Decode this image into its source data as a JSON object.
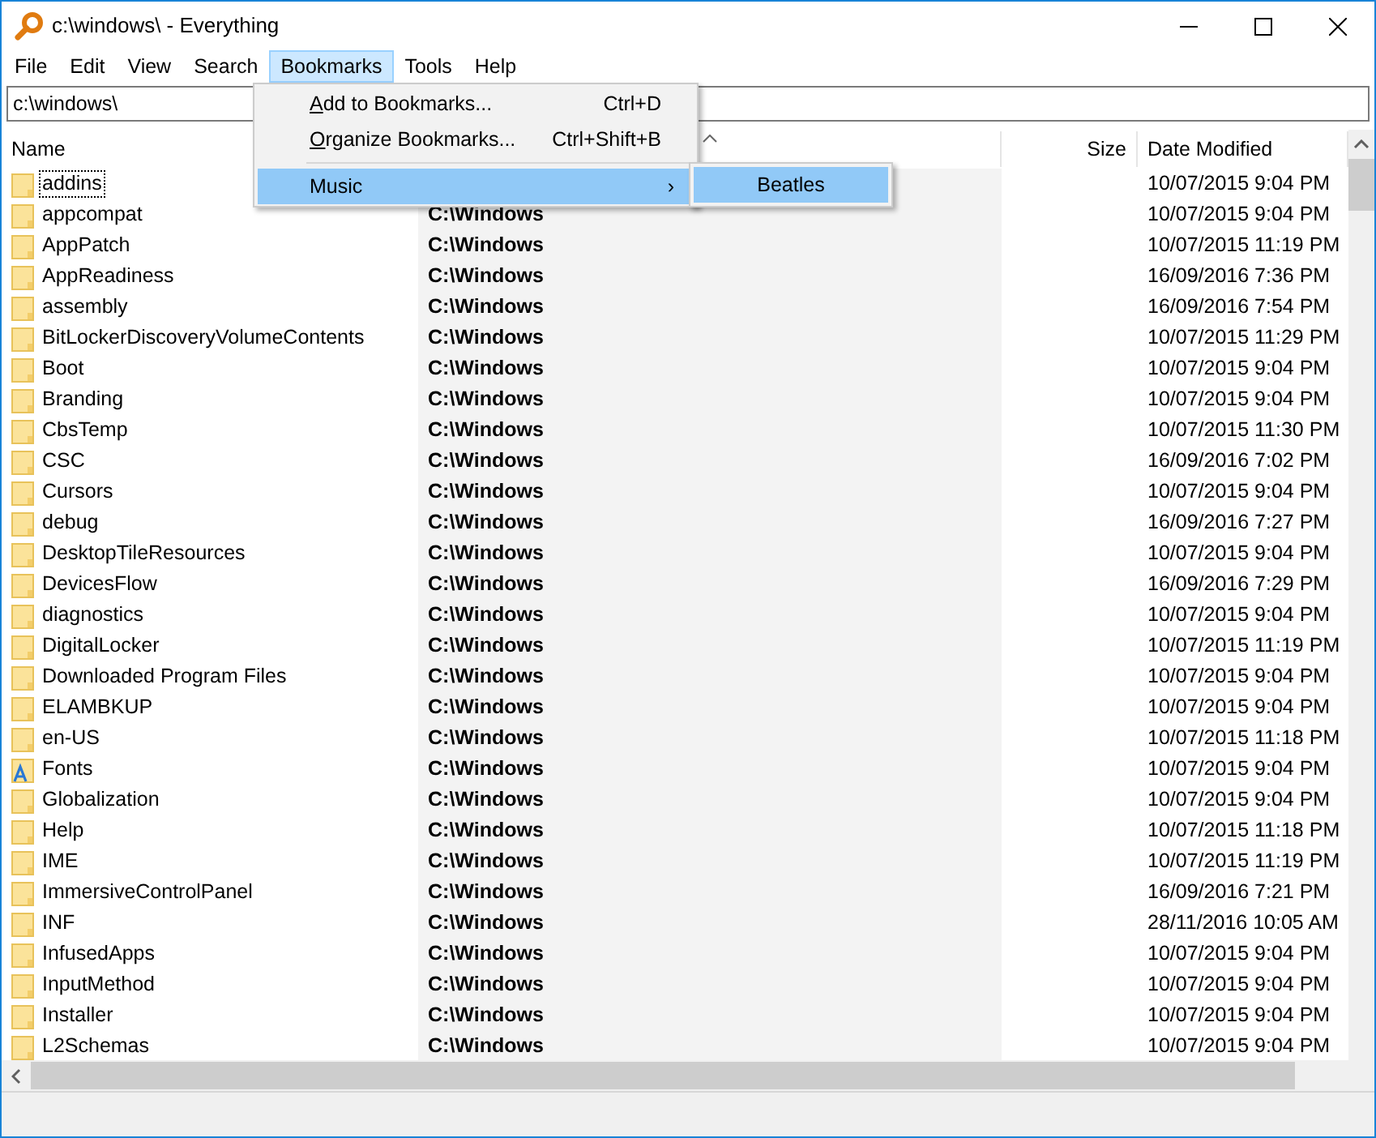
{
  "window": {
    "title": "c:\\windows\\ - Everything"
  },
  "menu_bar": [
    {
      "label": "File",
      "selected": false
    },
    {
      "label": "Edit",
      "selected": false
    },
    {
      "label": "View",
      "selected": false
    },
    {
      "label": "Search",
      "selected": false
    },
    {
      "label": "Bookmarks",
      "selected": true
    },
    {
      "label": "Tools",
      "selected": false
    },
    {
      "label": "Help",
      "selected": false
    }
  ],
  "search": {
    "value": "c:\\windows\\"
  },
  "columns": [
    {
      "label": "Name",
      "kind": "name",
      "sorted": false
    },
    {
      "kind": "path",
      "sorted": true
    },
    {
      "label": "Size",
      "kind": "size",
      "sorted": false
    },
    {
      "label": "Date Modified",
      "kind": "date",
      "sorted": false
    }
  ],
  "rows": [
    {
      "name": "addins",
      "date": "10/07/2015 9:04 PM",
      "kind": "folder",
      "focused": true
    },
    {
      "name": "appcompat",
      "path": "C:\\Windows",
      "date": "10/07/2015 9:04 PM",
      "kind": "folder",
      "focused": false
    },
    {
      "name": "AppPatch",
      "path": "C:\\Windows",
      "date": "10/07/2015 11:19 PM",
      "kind": "folder",
      "focused": false
    },
    {
      "name": "AppReadiness",
      "path": "C:\\Windows",
      "date": "16/09/2016 7:36 PM",
      "kind": "folder",
      "focused": false
    },
    {
      "name": "assembly",
      "path": "C:\\Windows",
      "date": "16/09/2016 7:54 PM",
      "kind": "folder",
      "focused": false
    },
    {
      "name": "BitLockerDiscoveryVolumeContents",
      "path": "C:\\Windows",
      "date": "10/07/2015 11:29 PM",
      "kind": "folder",
      "focused": false
    },
    {
      "name": "Boot",
      "path": "C:\\Windows",
      "date": "10/07/2015 9:04 PM",
      "kind": "folder",
      "focused": false
    },
    {
      "name": "Branding",
      "path": "C:\\Windows",
      "date": "10/07/2015 9:04 PM",
      "kind": "folder",
      "focused": false
    },
    {
      "name": "CbsTemp",
      "path": "C:\\Windows",
      "date": "10/07/2015 11:30 PM",
      "kind": "folder",
      "focused": false
    },
    {
      "name": "CSC",
      "path": "C:\\Windows",
      "date": "16/09/2016 7:02 PM",
      "kind": "folder",
      "focused": false
    },
    {
      "name": "Cursors",
      "path": "C:\\Windows",
      "date": "10/07/2015 9:04 PM",
      "kind": "folder",
      "focused": false
    },
    {
      "name": "debug",
      "path": "C:\\Windows",
      "date": "16/09/2016 7:27 PM",
      "kind": "folder",
      "focused": false
    },
    {
      "name": "DesktopTileResources",
      "path": "C:\\Windows",
      "date": "10/07/2015 9:04 PM",
      "kind": "folder",
      "focused": false
    },
    {
      "name": "DevicesFlow",
      "path": "C:\\Windows",
      "date": "16/09/2016 7:29 PM",
      "kind": "folder",
      "focused": false
    },
    {
      "name": "diagnostics",
      "path": "C:\\Windows",
      "date": "10/07/2015 9:04 PM",
      "kind": "folder",
      "focused": false
    },
    {
      "name": "DigitalLocker",
      "path": "C:\\Windows",
      "date": "10/07/2015 11:19 PM",
      "kind": "folder",
      "focused": false
    },
    {
      "name": "Downloaded Program Files",
      "path": "C:\\Windows",
      "date": "10/07/2015 9:04 PM",
      "kind": "folder",
      "focused": false
    },
    {
      "name": "ELAMBKUP",
      "path": "C:\\Windows",
      "date": "10/07/2015 9:04 PM",
      "kind": "folder",
      "focused": false
    },
    {
      "name": "en-US",
      "path": "C:\\Windows",
      "date": "10/07/2015 11:18 PM",
      "kind": "folder",
      "focused": false
    },
    {
      "name": "Fonts",
      "path": "C:\\Windows",
      "date": "10/07/2015 9:04 PM",
      "kind": "fonts",
      "focused": false
    },
    {
      "name": "Globalization",
      "path": "C:\\Windows",
      "date": "10/07/2015 9:04 PM",
      "kind": "folder",
      "focused": false
    },
    {
      "name": "Help",
      "path": "C:\\Windows",
      "date": "10/07/2015 11:18 PM",
      "kind": "folder",
      "focused": false
    },
    {
      "name": "IME",
      "path": "C:\\Windows",
      "date": "10/07/2015 11:19 PM",
      "kind": "folder",
      "focused": false
    },
    {
      "name": "ImmersiveControlPanel",
      "path": "C:\\Windows",
      "date": "16/09/2016 7:21 PM",
      "kind": "folder",
      "focused": false
    },
    {
      "name": "INF",
      "path": "C:\\Windows",
      "date": "28/11/2016 10:05 AM",
      "kind": "folder",
      "focused": false
    },
    {
      "name": "InfusedApps",
      "path": "C:\\Windows",
      "date": "10/07/2015 9:04 PM",
      "kind": "folder",
      "focused": false
    },
    {
      "name": "InputMethod",
      "path": "C:\\Windows",
      "date": "10/07/2015 9:04 PM",
      "kind": "folder",
      "focused": false
    },
    {
      "name": "Installer",
      "path": "C:\\Windows",
      "date": "10/07/2015 9:04 PM",
      "kind": "folder",
      "focused": false
    },
    {
      "name": "L2Schemas",
      "path": "C:\\Windows",
      "date": "10/07/2015 9:04 PM",
      "kind": "folder",
      "focused": false
    }
  ],
  "bookmarks_menu": [
    {
      "kind": "command",
      "key": "A",
      "rest": "dd to Bookmarks...",
      "shortcut": "Ctrl+D",
      "selected": false
    },
    {
      "kind": "command",
      "key": "O",
      "rest": "rganize Bookmarks...",
      "shortcut": "Ctrl+Shift+B",
      "selected": false
    },
    {
      "kind": "separator"
    },
    {
      "kind": "submenu",
      "label": "Music",
      "arrow": "›",
      "selected": true
    }
  ],
  "submenu": [
    {
      "label": "Beatles",
      "selected": true
    }
  ]
}
